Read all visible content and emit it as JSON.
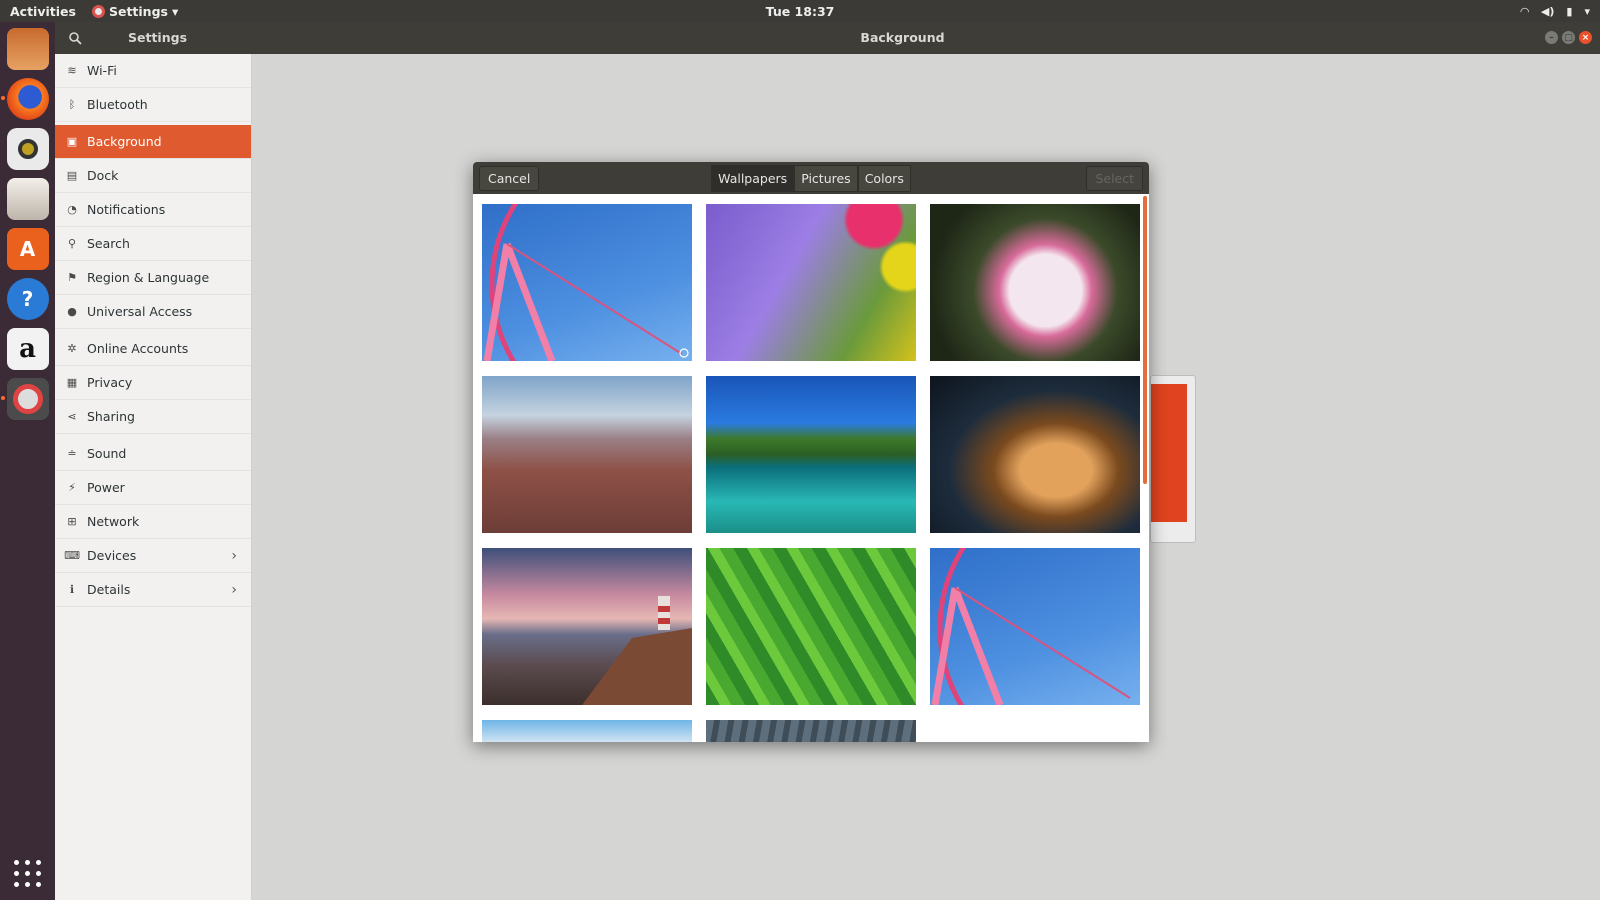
{
  "topbar": {
    "activities": "Activities",
    "app_menu": "Settings",
    "clock": "Tue 18:37"
  },
  "dock": {
    "apps": [
      "files-app-icon",
      "firefox-icon",
      "rhythmbox-icon",
      "file-manager-icon",
      "software-center-icon",
      "help-icon",
      "amazon-icon",
      "settings-icon"
    ]
  },
  "window": {
    "sidebar_title": "Settings",
    "main_title": "Background"
  },
  "sidebar": {
    "items": [
      {
        "label": "Wi-Fi",
        "icon": "wifi-icon"
      },
      {
        "label": "Bluetooth",
        "icon": "bluetooth-icon"
      },
      {
        "label": "Background",
        "icon": "background-icon",
        "active": true
      },
      {
        "label": "Dock",
        "icon": "dock-icon"
      },
      {
        "label": "Notifications",
        "icon": "notifications-icon"
      },
      {
        "label": "Search",
        "icon": "search-icon"
      },
      {
        "label": "Region & Language",
        "icon": "region-icon"
      },
      {
        "label": "Universal Access",
        "icon": "universal-access-icon"
      },
      {
        "label": "Online Accounts",
        "icon": "online-accounts-icon"
      },
      {
        "label": "Privacy",
        "icon": "privacy-icon"
      },
      {
        "label": "Sharing",
        "icon": "sharing-icon"
      },
      {
        "label": "Sound",
        "icon": "sound-icon"
      },
      {
        "label": "Power",
        "icon": "power-icon"
      },
      {
        "label": "Network",
        "icon": "network-icon"
      },
      {
        "label": "Devices",
        "icon": "devices-icon"
      },
      {
        "label": "Details",
        "icon": "details-icon"
      }
    ]
  },
  "dialog": {
    "cancel_label": "Cancel",
    "select_label": "Select",
    "tabs": [
      "Wallpapers",
      "Pictures",
      "Colors"
    ],
    "selected_tab": "Wallpapers",
    "wallpapers": [
      "ferris-wheel",
      "lavender",
      "lily",
      "canyon",
      "island",
      "guitar",
      "lighthouse",
      "leaves",
      "ferris-wheel",
      "sky",
      "pier"
    ]
  },
  "colors": {
    "accent": "#df5b2f",
    "header": "#3e3d38",
    "dock": "#3a2b36"
  }
}
